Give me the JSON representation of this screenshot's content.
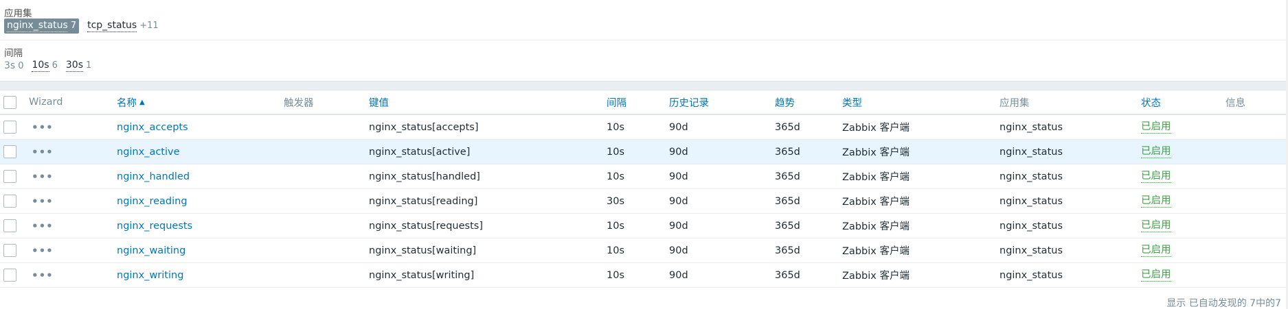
{
  "filter": {
    "app_set_label": "应用集",
    "app_tags": [
      {
        "label": "nginx_status",
        "count": "7",
        "selected": true
      },
      {
        "label": "tcp_status",
        "count": "+11",
        "selected": false
      }
    ],
    "interval_label": "间隔",
    "interval_tags": [
      {
        "label": "3s",
        "count": "0",
        "plain": true
      },
      {
        "label": "10s",
        "count": "6",
        "plain": false
      },
      {
        "label": "30s",
        "count": "1",
        "plain": false
      }
    ]
  },
  "table": {
    "headers": {
      "wizard": "Wizard",
      "name": "名称",
      "trigger": "触发器",
      "key": "键值",
      "interval": "间隔",
      "history": "历史记录",
      "trend": "趋势",
      "type": "类型",
      "app_set": "应用集",
      "status": "状态",
      "info": "信息"
    },
    "sort_arrow": "▲",
    "rows": [
      {
        "name": "nginx_accepts",
        "key": "nginx_status[accepts]",
        "interval": "10s",
        "history": "90d",
        "trend": "365d",
        "type": "Zabbix 客户端",
        "app": "nginx_status",
        "status": "已启用"
      },
      {
        "name": "nginx_active",
        "key": "nginx_status[active]",
        "interval": "10s",
        "history": "90d",
        "trend": "365d",
        "type": "Zabbix 客户端",
        "app": "nginx_status",
        "status": "已启用"
      },
      {
        "name": "nginx_handled",
        "key": "nginx_status[handled]",
        "interval": "10s",
        "history": "90d",
        "trend": "365d",
        "type": "Zabbix 客户端",
        "app": "nginx_status",
        "status": "已启用"
      },
      {
        "name": "nginx_reading",
        "key": "nginx_status[reading]",
        "interval": "30s",
        "history": "90d",
        "trend": "365d",
        "type": "Zabbix 客户端",
        "app": "nginx_status",
        "status": "已启用"
      },
      {
        "name": "nginx_requests",
        "key": "nginx_status[requests]",
        "interval": "10s",
        "history": "90d",
        "trend": "365d",
        "type": "Zabbix 客户端",
        "app": "nginx_status",
        "status": "已启用"
      },
      {
        "name": "nginx_waiting",
        "key": "nginx_status[waiting]",
        "interval": "10s",
        "history": "90d",
        "trend": "365d",
        "type": "Zabbix 客户端",
        "app": "nginx_status",
        "status": "已启用"
      },
      {
        "name": "nginx_writing",
        "key": "nginx_status[writing]",
        "interval": "10s",
        "history": "90d",
        "trend": "365d",
        "type": "Zabbix 客户端",
        "app": "nginx_status",
        "status": "已启用"
      }
    ],
    "row_menu_glyph": "•••"
  },
  "footer": {
    "summary": "显示 已自动发现的 7中的7"
  }
}
